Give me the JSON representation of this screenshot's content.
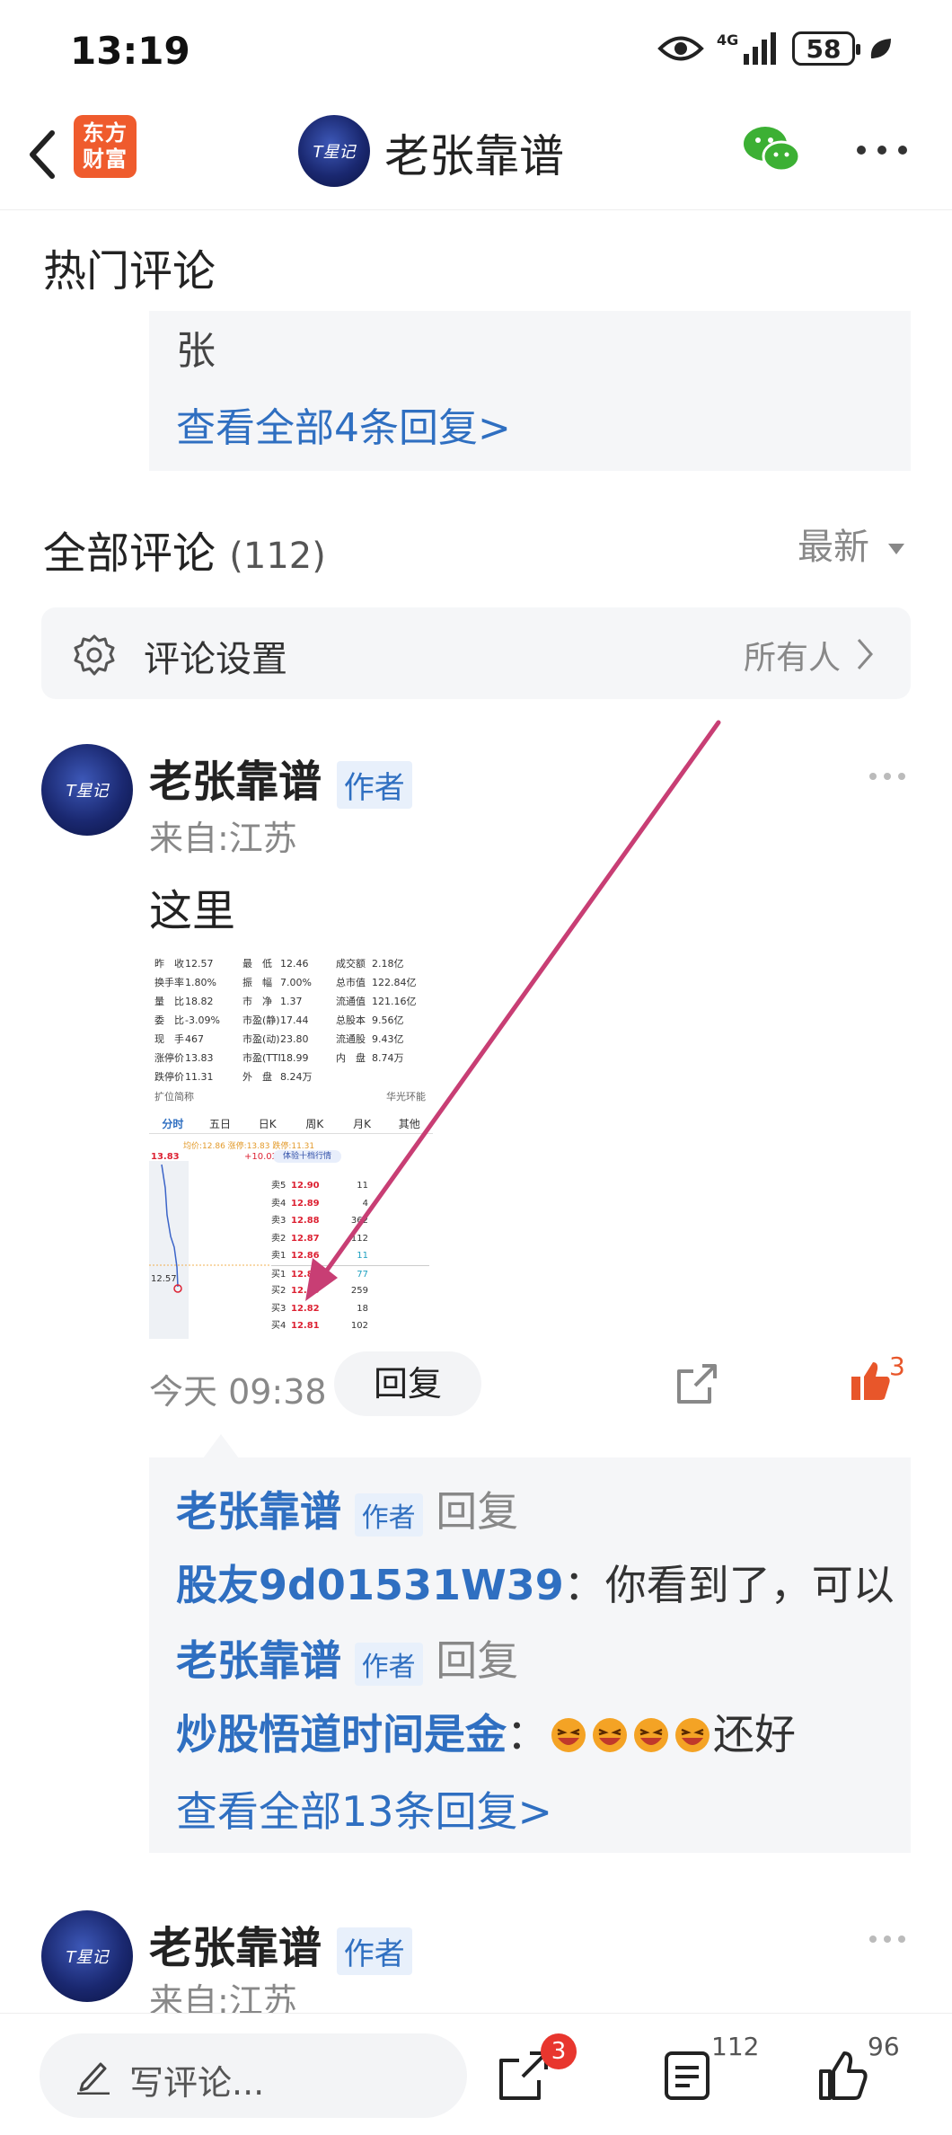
{
  "status_bar": {
    "time": "13:19",
    "network": "4G",
    "battery": "58"
  },
  "navbar": {
    "logo_line1": "东方",
    "logo_line2": "财富",
    "title": "老张靠谱",
    "avatar_text": "T星记"
  },
  "hot_comments": {
    "title": "热门评论",
    "snippet": "张",
    "view_all": "查看全部4条回复>"
  },
  "all_comments": {
    "title": "全部评论",
    "count": "(112)",
    "sort": "最新"
  },
  "settings": {
    "label": "评论设置",
    "value": "所有人"
  },
  "comment1": {
    "author": "老张靠谱",
    "author_tag": "作者",
    "location": "来自:江苏",
    "text": "这里",
    "time": "今天 09:38",
    "reply_button": "回复",
    "likes": "3",
    "replies": [
      {
        "name": "老张靠谱",
        "tag": "作者",
        "action": "回复"
      },
      {
        "name": "股友9d01531W39",
        "text": "：你看到了，可以"
      },
      {
        "name": "老张靠谱",
        "tag": "作者",
        "action": "回复"
      },
      {
        "name": "炒股悟道时间是金",
        "text": "：",
        "suffix": "还好"
      }
    ],
    "view_all": "查看全部13条回复>"
  },
  "comment2": {
    "author": "老张靠谱",
    "author_tag": "作者",
    "location": "来自:江苏"
  },
  "screenshot": {
    "stats": [
      [
        "昨　收",
        "12.57",
        "最　低",
        "12.46",
        "成交额",
        "2.18亿"
      ],
      [
        "换手率",
        "1.80%",
        "振　幅",
        "7.00%",
        "总市值",
        "122.84亿"
      ],
      [
        "量　比",
        "18.82",
        "市　净",
        "1.37",
        "流通值",
        "121.16亿"
      ],
      [
        "委　比",
        "-3.09%",
        "市盈(静)",
        "17.44",
        "总股本",
        "9.56亿"
      ],
      [
        "现　手",
        "467",
        "市盈(动)",
        "23.80",
        "流通股",
        "9.43亿"
      ],
      [
        "涨停价",
        "13.83",
        "市盈(TTM)",
        "18.99",
        "内　盘",
        "8.74万"
      ],
      [
        "跌停价",
        "11.31",
        "外　盘",
        "8.24万",
        "",
        ""
      ]
    ],
    "footer_left": "扩位简称",
    "footer_right": "华光环能",
    "tabs": [
      "分时",
      "五日",
      "日K",
      "周K",
      "月K",
      "其他"
    ],
    "chart_header": "均价:12.86 涨停:13.83 跌停:11.31",
    "change": "+10.02%",
    "price_top": "13.83",
    "price_mid": "12.57",
    "promo": "体验十档行情",
    "order_book": [
      [
        "卖5",
        "12.90",
        "11"
      ],
      [
        "卖4",
        "12.89",
        "4"
      ],
      [
        "卖3",
        "12.88",
        "362"
      ],
      [
        "卖2",
        "12.87",
        "112"
      ],
      [
        "卖1",
        "12.86",
        "11"
      ],
      [
        "买1",
        "12.85",
        "77"
      ],
      [
        "买2",
        "12.83",
        "259"
      ],
      [
        "买3",
        "12.82",
        "18"
      ],
      [
        "买4",
        "12.81",
        "102"
      ]
    ]
  },
  "bottom_bar": {
    "placeholder": "写评论...",
    "share_badge": "3",
    "comment_count": "112",
    "like_count": "96"
  }
}
